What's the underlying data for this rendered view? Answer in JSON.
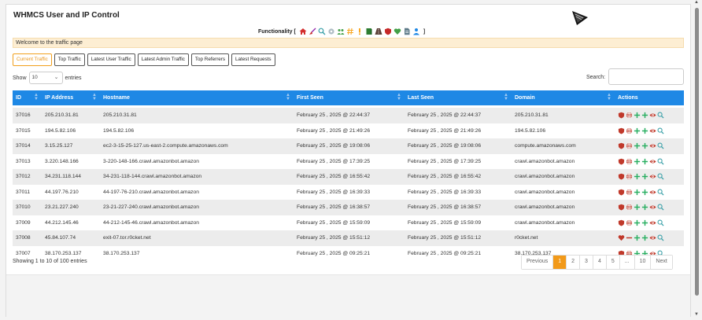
{
  "header": {
    "title": "WHMCS User and IP Control",
    "functionality_label": "Functionality [",
    "functionality_close": "]",
    "functionality_icons": [
      "home-icon",
      "broom-icon",
      "search-icon",
      "gear-icon",
      "users-icon",
      "hashtag-icon",
      "exclamation-icon",
      "book-icon",
      "road-icon",
      "shield-icon",
      "heart-icon",
      "document-icon",
      "user-tie-icon"
    ]
  },
  "welcome": "Welcome to the traffic page",
  "tabs": [
    "Current Traffic",
    "Top Traffic",
    "Latest User Traffic",
    "Latest Admin Traffic",
    "Top Referrers",
    "Latest Requests"
  ],
  "controls": {
    "show_label": "Show",
    "entries_value": "10",
    "entries_label": "entries",
    "search_label": "Search:"
  },
  "table": {
    "columns": [
      "ID",
      "IP Address",
      "Hostname",
      "First Seen",
      "Last Seen",
      "Domain",
      "Actions"
    ],
    "rows": [
      [
        "37016",
        "205.210.31.81",
        "205.210.31.81",
        "February 25 , 2025 @ 22:44:37",
        "February 25 , 2025 @ 22:44:37",
        "205.210.31.81"
      ],
      [
        "37015",
        "194.5.82.106",
        "194.5.82.106",
        "February 25 , 2025 @ 21:49:26",
        "February 25 , 2025 @ 21:49:26",
        "194.5.82.106"
      ],
      [
        "37014",
        "3.15.25.127",
        "ec2-3-15-25-127.us-east-2.compute.amazonaws.com",
        "February 25 , 2025 @ 19:08:06",
        "February 25 , 2025 @ 19:08:06",
        "compute.amazonaws.com"
      ],
      [
        "37013",
        "3.220.148.166",
        "3-220-148-166.crawl.amazonbot.amazon",
        "February 25 , 2025 @ 17:39:25",
        "February 25 , 2025 @ 17:39:25",
        "crawl.amazonbot.amazon"
      ],
      [
        "37012",
        "34.231.118.144",
        "34-231-118-144.crawl.amazonbot.amazon",
        "February 25 , 2025 @ 16:55:42",
        "February 25 , 2025 @ 16:55:42",
        "crawl.amazonbot.amazon"
      ],
      [
        "37011",
        "44.197.76.210",
        "44-197-76-210.crawl.amazonbot.amazon",
        "February 25 , 2025 @ 16:39:33",
        "February 25 , 2025 @ 16:39:33",
        "crawl.amazonbot.amazon"
      ],
      [
        "37010",
        "23.21.227.240",
        "23-21-227-240.crawl.amazonbot.amazon",
        "February 25 , 2025 @ 16:38:57",
        "February 25 , 2025 @ 16:38:57",
        "crawl.amazonbot.amazon"
      ],
      [
        "37009",
        "44.212.145.46",
        "44-212-145-46.crawl.amazonbot.amazon",
        "February 25 , 2025 @ 15:59:09",
        "February 25 , 2025 @ 15:59:09",
        "crawl.amazonbot.amazon"
      ],
      [
        "37008",
        "45.84.107.74",
        "exit-07.tor.r0cket.net",
        "February 25 , 2025 @ 15:51:12",
        "February 25 , 2025 @ 15:51:12",
        "r0cket.net"
      ],
      [
        "37007",
        "38.170.253.137",
        "38.170.253.137",
        "February 25 , 2025 @ 09:25:21",
        "February 25 , 2025 @ 09:25:21",
        "38.170.253.137"
      ]
    ],
    "row_actions": [
      "shield-icon",
      "globe-icon",
      "plus-icon",
      "plus-icon",
      "eye-icon",
      "search-icon"
    ],
    "row_actions_alt": [
      "heart-icon",
      "minus-icon",
      "plus-icon",
      "plus-icon",
      "eye-icon",
      "search-icon"
    ]
  },
  "footer": {
    "info": "Showing 1 to 10 of 100 entries",
    "pages": [
      "Previous",
      "1",
      "2",
      "3",
      "4",
      "5",
      "...",
      "10",
      "Next"
    ],
    "active_page": "1"
  },
  "colors": {
    "header_blue": "#1e88e5",
    "accent_orange": "#f29a1a",
    "shield_red": "#c0392b",
    "plus_green": "#27ae60",
    "search_teal": "#3aa0a8"
  }
}
